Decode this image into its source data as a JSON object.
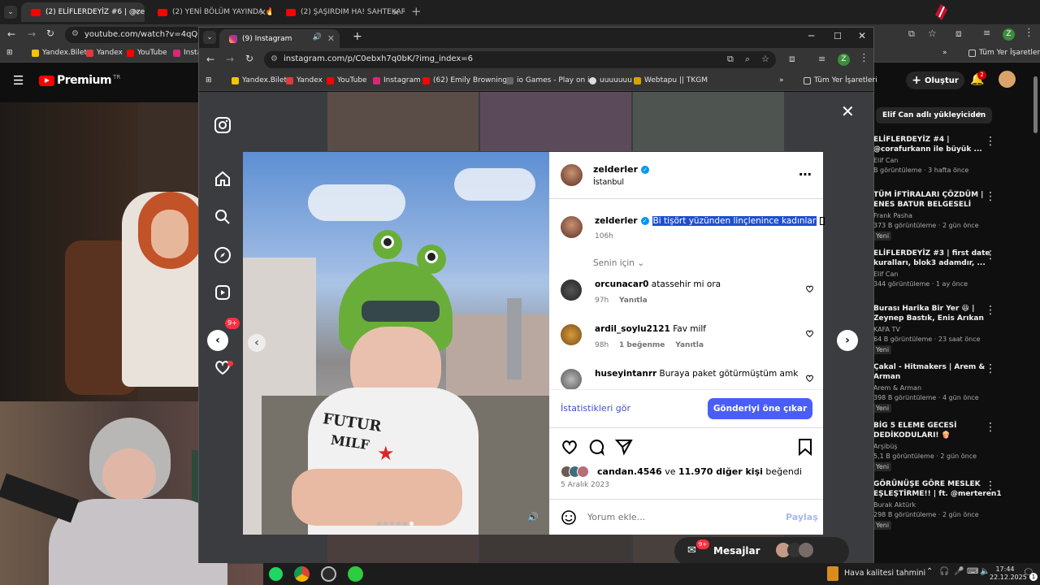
{
  "back_browser": {
    "tabs": [
      {
        "title": "(2) ELİFLERDEYİZ #6 | @zelderle"
      },
      {
        "title": "(2) YENİ BÖLÜM YAYINDA 🔥 @"
      },
      {
        "title": "(2) ŞAŞIRDIM HA! SAHTEKARL/"
      }
    ],
    "url": "youtube.com/watch?v=4qQbW7p",
    "bookmarks": [
      "Yandex.Bilet",
      "Yandex",
      "YouTube",
      "Insta"
    ],
    "right_bookmark": "Tüm Yer İşaretleri",
    "profile_letter": "Z"
  },
  "youtube": {
    "logo_text": "Premium",
    "logo_sup": "TR",
    "create_label": "Oluştur",
    "notif_count": "2",
    "channel_chip": "Elif Can adlı yükleyiciden",
    "sidebar": [
      {
        "title1": "ELİFLERDEYİZ #4 |",
        "title2": "@corafurkann ile büyük ...",
        "channel": "Elif Can",
        "meta": "B görüntüleme · 3 hafta önce",
        "badge": ""
      },
      {
        "title1": "TÜM İFTİRALARI ÇÖZDÜM |",
        "title2": "ENES BATUR BELGESELİ",
        "channel": "Frank Pasha",
        "meta": "373 B görüntüleme · 2 gün önce",
        "badge": "Yeni"
      },
      {
        "title1": "ELİFLERDEYİZ #3 | first date",
        "title2": "kuralları, blok3 adamdır, ...",
        "channel": "Elif Can",
        "meta": "344 görüntüleme · 1 ay önce",
        "badge": ""
      },
      {
        "title1": "Burası Harika Bir Yer 😆 |",
        "title2": "Zeynep Bastık, Enis Arıkan",
        "channel": "KAFA TV",
        "meta": "64 B görüntüleme · 23 saat önce",
        "badge": "Yeni"
      },
      {
        "title1": "Çakal - Hitmakers | Arem &",
        "title2": "Arman",
        "channel": "Arem & Arman",
        "meta": "398 B görüntüleme · 4 gün önce",
        "badge": "Yeni"
      },
      {
        "title1": "BİG 5 ELEME GECESİ",
        "title2": "DEDİKODULARI! 🍿",
        "channel": "Arşibüş",
        "meta": "5,1 B görüntüleme · 2 gün önce",
        "badge": "Yeni"
      },
      {
        "title1": "GÖRÜNÜŞE GÖRE MESLEK",
        "title2": "EŞLEŞTİRME!! | ft. @merteren1",
        "channel": "Burak Aktürk",
        "meta": "298 B görüntüleme · 2 gün önce",
        "badge": "Yeni"
      }
    ]
  },
  "front_browser": {
    "tab_title": "(9) Instagram",
    "url": "instagram.com/p/C0ebxh7q0bK/?img_index=6",
    "bookmarks": [
      "Yandex.Bilet",
      "Yandex",
      "YouTube",
      "Instagram",
      "(62) Emily Browning...",
      "io Games - Play on i...",
      "uuuuuuu",
      "Webtapu || TKGM"
    ],
    "right_bookmark": "Tüm Yer İşaretleri",
    "profile_letter": "Z"
  },
  "instagram": {
    "notif_badge": "9+",
    "post_owner": "zelderler",
    "location": "İstanbul",
    "caption": "Bi tişört yüzünden linçlenince kadınlar",
    "caption_time": "106h",
    "filter_label": "Senin için",
    "comments": [
      {
        "user": "orcunacar0",
        "text": "atassehir mi ora",
        "time": "97h",
        "likes": "",
        "reply": "Yanıtla"
      },
      {
        "user": "ardil_soylu2121",
        "text": "Fav milf",
        "time": "98h",
        "likes": "1 beğenme",
        "reply": "Yanıtla"
      },
      {
        "user": "huseyintanrr",
        "text": "Buraya paket götürmüştüm amk",
        "time": "",
        "likes": "",
        "reply": ""
      }
    ],
    "insights_label": "İstatistikleri gör",
    "boost_label": "Gönderiyi öne çıkar",
    "liked_by_user": "candan.4546",
    "liked_and": "ve",
    "liked_others": "11.970 diğer kişi",
    "liked_suffix": "beğendi",
    "post_date": "5 Aralık 2023",
    "comment_placeholder": "Yorum ekle...",
    "share_label": "Paylaş",
    "messages_label": "Mesajlar",
    "messages_badge": "9+",
    "shirt_text_1": "FUTUR",
    "shirt_text_2": "MILF"
  },
  "taskbar": {
    "weather": "Hava kalitesi tahmini",
    "time": "17:44",
    "date": "22.12.2025",
    "notif_count": "1"
  },
  "colors": {
    "ig_blue": "#4f5bd5",
    "ig_button": "#4a5df9",
    "yt_red": "#ff0000",
    "selection": "#1f4fcf"
  }
}
